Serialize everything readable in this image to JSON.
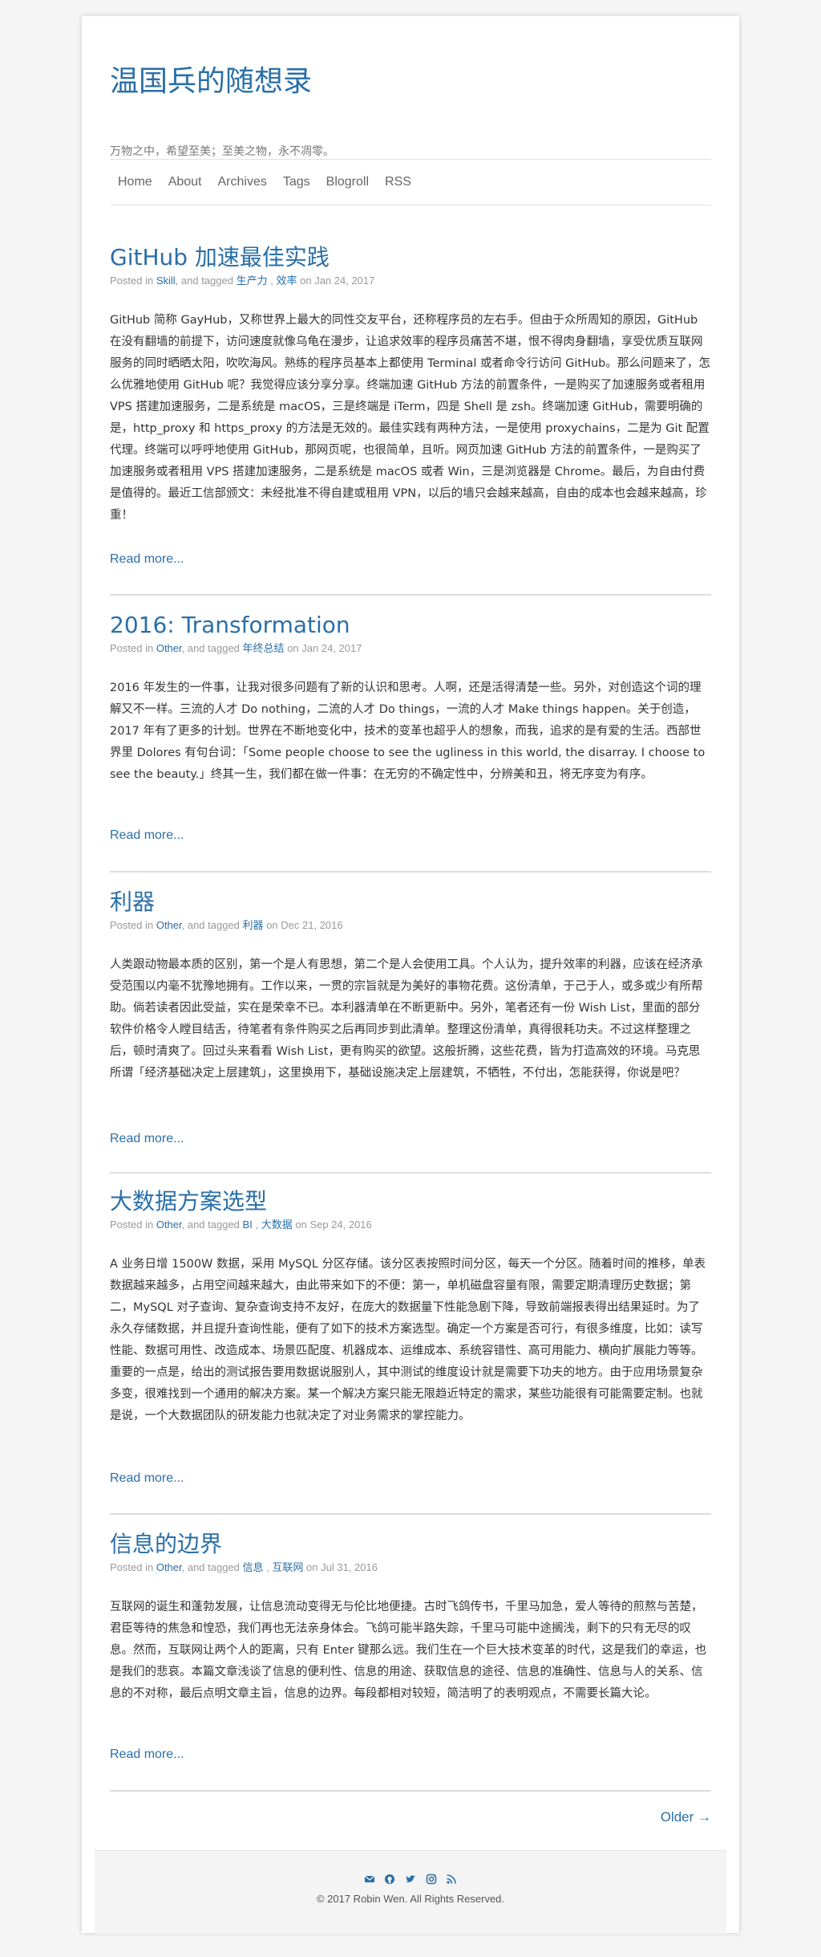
{
  "site": {
    "title": "温国兵的随想录",
    "description": "万物之中，希望至美；至美之物，永不凋零。"
  },
  "nav": [
    "Home",
    "About",
    "Archives",
    "Tags",
    "Blogroll",
    "RSS"
  ],
  "posts": [
    {
      "title": "GitHub 加速最佳实践",
      "meta_prefix": "Posted in",
      "category": "Skill",
      "meta_mid": ", and tagged",
      "tags": [
        "生产力",
        "效率"
      ],
      "meta_on": "on",
      "date": "Jan 24, 2017",
      "excerpt": "GitHub 简称 GayHub，又称世界上最大的同性交友平台，还称程序员的左右手。但由于众所周知的原因，GitHub 在没有翻墙的前提下，访问速度就像乌龟在漫步，让追求效率的程序员痛苦不堪，恨不得肉身翻墙，享受优质互联网服务的同时晒晒太阳，吹吹海风。熟练的程序员基本上都使用 Terminal 或者命令行访问 GitHub。那么问题来了，怎么优雅地使用 GitHub 呢？我觉得应该分享分享。终端加速 GitHub 方法的前置条件，一是购买了加速服务或者租用 VPS 搭建加速服务，二是系统是 macOS，三是终端是 iTerm，四是 Shell 是 zsh。终端加速 GitHub，需要明确的是，http_proxy 和 https_proxy 的方法是无效的。最佳实践有两种方法，一是使用 proxychains，二是为 Git 配置代理。终端可以呼呼地使用 GitHub，那网页呢，也很简单，且听。网页加速 GitHub 方法的前置条件，一是购买了加速服务或者租用 VPS 搭建加速服务，二是系统是 macOS 或者 Win，三是浏览器是 Chrome。最后，为自由付费是值得的。最近工信部颁文：未经批准不得自建或租用 VPN，以后的墙只会越来越高，自由的成本也会越来越高，珍重！",
      "read_more": "Read more..."
    },
    {
      "title": "2016: Transformation",
      "meta_prefix": "Posted in",
      "category": "Other",
      "meta_mid": ", and tagged",
      "tags": [
        "年终总结"
      ],
      "meta_on": "on",
      "date": "Jan 24, 2017",
      "excerpt": "2016 年发生的一件事，让我对很多问题有了新的认识和思考。人啊，还是活得清楚一些。另外，对创造这个词的理解又不一样。三流的人才 Do nothing，二流的人才 Do things，一流的人才 Make things happen。关于创造，2017 年有了更多的计划。世界在不断地变化中，技术的变革也超乎人的想象，而我，追求的是有爱的生活。西部世界里 Dolores 有句台词：「Some people choose to see the ugliness in this world, the disarray. I choose to see the beauty.」终其一生，我们都在做一件事：在无穷的不确定性中，分辨美和丑，将无序变为有序。",
      "read_more": "Read more..."
    },
    {
      "title": "利器",
      "meta_prefix": "Posted in",
      "category": "Other",
      "meta_mid": ", and tagged",
      "tags": [
        "利器"
      ],
      "meta_on": "on",
      "date": "Dec 21, 2016",
      "excerpt": "人类跟动物最本质的区别，第一个是人有思想，第二个是人会使用工具。个人认为，提升效率的利器，应该在经济承受范围以内毫不犹豫地拥有。工作以来，一贯的宗旨就是为美好的事物花费。这份清单，于己于人，或多或少有所帮助。倘若读者因此受益，实在是荣幸不已。本利器清单在不断更新中。另外，笔者还有一份 Wish List，里面的部分软件价格令人瞠目结舌，待笔者有条件购买之后再同步到此清单。整理这份清单，真得很耗功夫。不过这样整理之后，顿时清爽了。回过头来看看 Wish List，更有购买的欲望。这般折腾，这些花费，皆为打造高效的环境。马克思所谓「经济基础决定上层建筑」，这里换用下，基础设施决定上层建筑，不牺牲，不付出，怎能获得，你说是吧？",
      "read_more": "Read more..."
    },
    {
      "title": "大数据方案选型",
      "meta_prefix": "Posted in",
      "category": "Other",
      "meta_mid": ", and tagged",
      "tags": [
        "BI",
        "大数据"
      ],
      "meta_on": "on",
      "date": "Sep 24, 2016",
      "excerpt": "A 业务日增 1500W 数据，采用 MySQL 分区存储。该分区表按照时间分区，每天一个分区。随着时间的推移，单表数据越来越多，占用空间越来越大，由此带来如下的不便：第一，单机磁盘容量有限，需要定期清理历史数据；第二，MySQL 对子查询、复杂查询支持不友好，在庞大的数据量下性能急剧下降，导致前端报表得出结果延时。为了永久存储数据，并且提升查询性能，便有了如下的技术方案选型。确定一个方案是否可行，有很多维度，比如：读写性能、数据可用性、改造成本、场景匹配度、机器成本、运维成本、系统容错性、高可用能力、横向扩展能力等等。重要的一点是，给出的测试报告要用数据说服别人，其中测试的维度设计就是需要下功夫的地方。由于应用场景复杂多变，很难找到一个通用的解决方案。某一个解决方案只能无限趋近特定的需求，某些功能很有可能需要定制。也就是说，一个大数据团队的研发能力也就决定了对业务需求的掌控能力。",
      "read_more": "Read more..."
    },
    {
      "title": "信息的边界",
      "meta_prefix": "Posted in",
      "category": "Other",
      "meta_mid": ", and tagged",
      "tags": [
        "信息",
        "互联网"
      ],
      "meta_on": "on",
      "date": "Jul 31, 2016",
      "excerpt": "互联网的诞生和蓬勃发展，让信息流动变得无与伦比地便捷。古时飞鸽传书，千里马加急，爱人等待的煎熬与苦楚，君臣等待的焦急和惶恐，我们再也无法亲身体会。飞鸽可能半路失踪，千里马可能中途搁浅，剩下的只有无尽的叹息。然而，互联网让两个人的距离，只有 Enter 键那么远。我们生在一个巨大技术变革的时代，这是我们的幸运，也是我们的悲哀。本篇文章浅谈了信息的便利性、信息的用途、获取信息的途径、信息的准确性、信息与人的关系、信息的不对称，最后点明文章主旨，信息的边界。每段都相对较短，简洁明了的表明观点，不需要长篇大论。",
      "read_more": "Read more..."
    }
  ],
  "pagination": {
    "older": "Older →"
  },
  "footer": {
    "icons": [
      "email-icon",
      "github-icon",
      "twitter-icon",
      "instagram-icon",
      "rss-icon"
    ],
    "copyright": "© 2017 Robin Wen. All Rights Reserved."
  },
  "colors": {
    "link": "#2a6fa8",
    "text": "#333333",
    "muted": "#999999"
  }
}
